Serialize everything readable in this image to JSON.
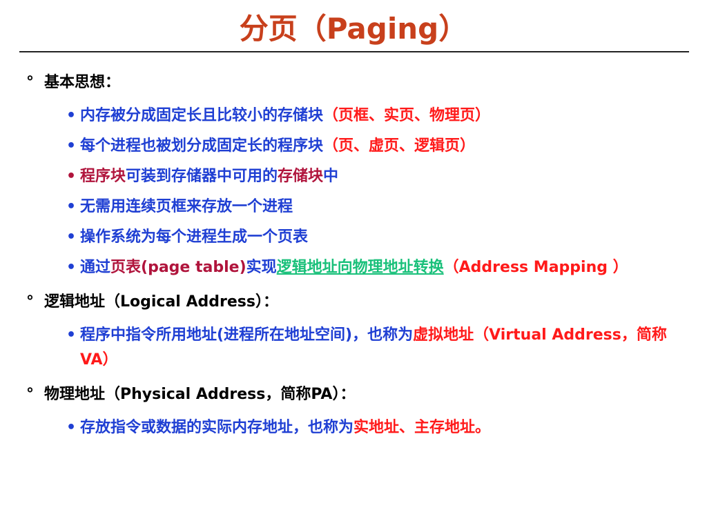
{
  "title": "分页（Paging）",
  "sections": [
    {
      "marker": "°",
      "heading": "基本思想：",
      "items": [
        {
          "bullet": "•",
          "a": "内存被分成固定长且比较小的存储块",
          "b": "（页框、实页、物理页）"
        },
        {
          "bullet": "•",
          "a": "每个进程也被划分成固定长的程序块",
          "b": "（页、虚页、逻辑页）"
        },
        {
          "bullet": "•",
          "a": "程序块",
          "b": "可装到存储器中可用的",
          "c": "存储块",
          "d": "中"
        },
        {
          "bullet": "•",
          "a": "无需用连续页框来存放一个进程"
        },
        {
          "bullet": "•",
          "a": "操作系统为每个进程生成一个页表"
        },
        {
          "bullet": "•",
          "a": "通过",
          "b": "页表(page table)",
          "c": "实现",
          "d": "逻辑地址向物理地址转换",
          "e": "（Address Mapping ）"
        }
      ]
    },
    {
      "marker": "°",
      "heading": "逻辑地址（Logical Address）：",
      "items": [
        {
          "bullet": "•",
          "a": "程序中指令所用地址(进程所在地址空间)，也称为",
          "b": "虚拟地址（Virtual Address，简称VA）"
        }
      ]
    },
    {
      "marker": "°",
      "heading": "物理地址（Physical Address，简称PA）：",
      "items": [
        {
          "bullet": "•",
          "a": "存放指令或数据的实际内存地址，也称为",
          "b": "实地址、主存地址。"
        }
      ]
    }
  ]
}
